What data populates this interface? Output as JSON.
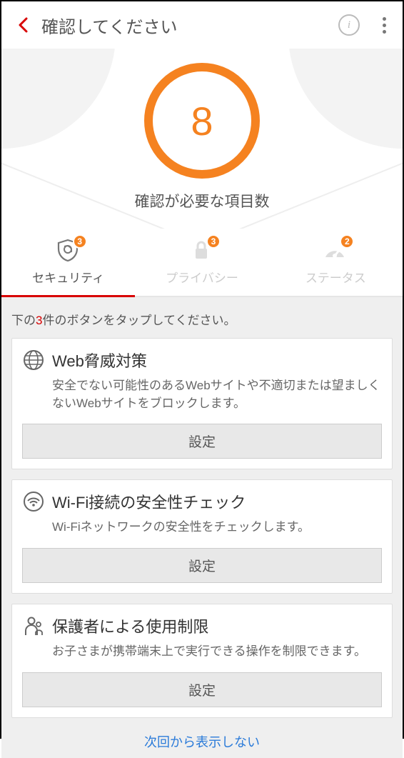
{
  "header": {
    "title": "確認してください"
  },
  "hero": {
    "count": "8",
    "subtitle": "確認が必要な項目数"
  },
  "tabs": [
    {
      "label": "セキュリティ",
      "badge": "3",
      "active": true
    },
    {
      "label": "プライバシー",
      "badge": "3",
      "active": false
    },
    {
      "label": "ステータス",
      "badge": "2",
      "active": false
    }
  ],
  "instruction": {
    "prefix": "下の",
    "count": "3",
    "suffix": "件のボタンをタップしてください。"
  },
  "cards": [
    {
      "title": "Web脅威対策",
      "desc": "安全でない可能性のあるWebサイトや不適切または望ましくないWebサイトをブロックします。",
      "button": "設定"
    },
    {
      "title": "Wi-Fi接続の安全性チェック",
      "desc": "Wi-Fiネットワークの安全性をチェックします。",
      "button": "設定"
    },
    {
      "title": "保護者による使用制限",
      "desc": "お子さまが携帯端末上で実行できる操作を制限できます。",
      "button": "設定"
    }
  ],
  "footer": {
    "skip_label": "次回から表示しない"
  }
}
